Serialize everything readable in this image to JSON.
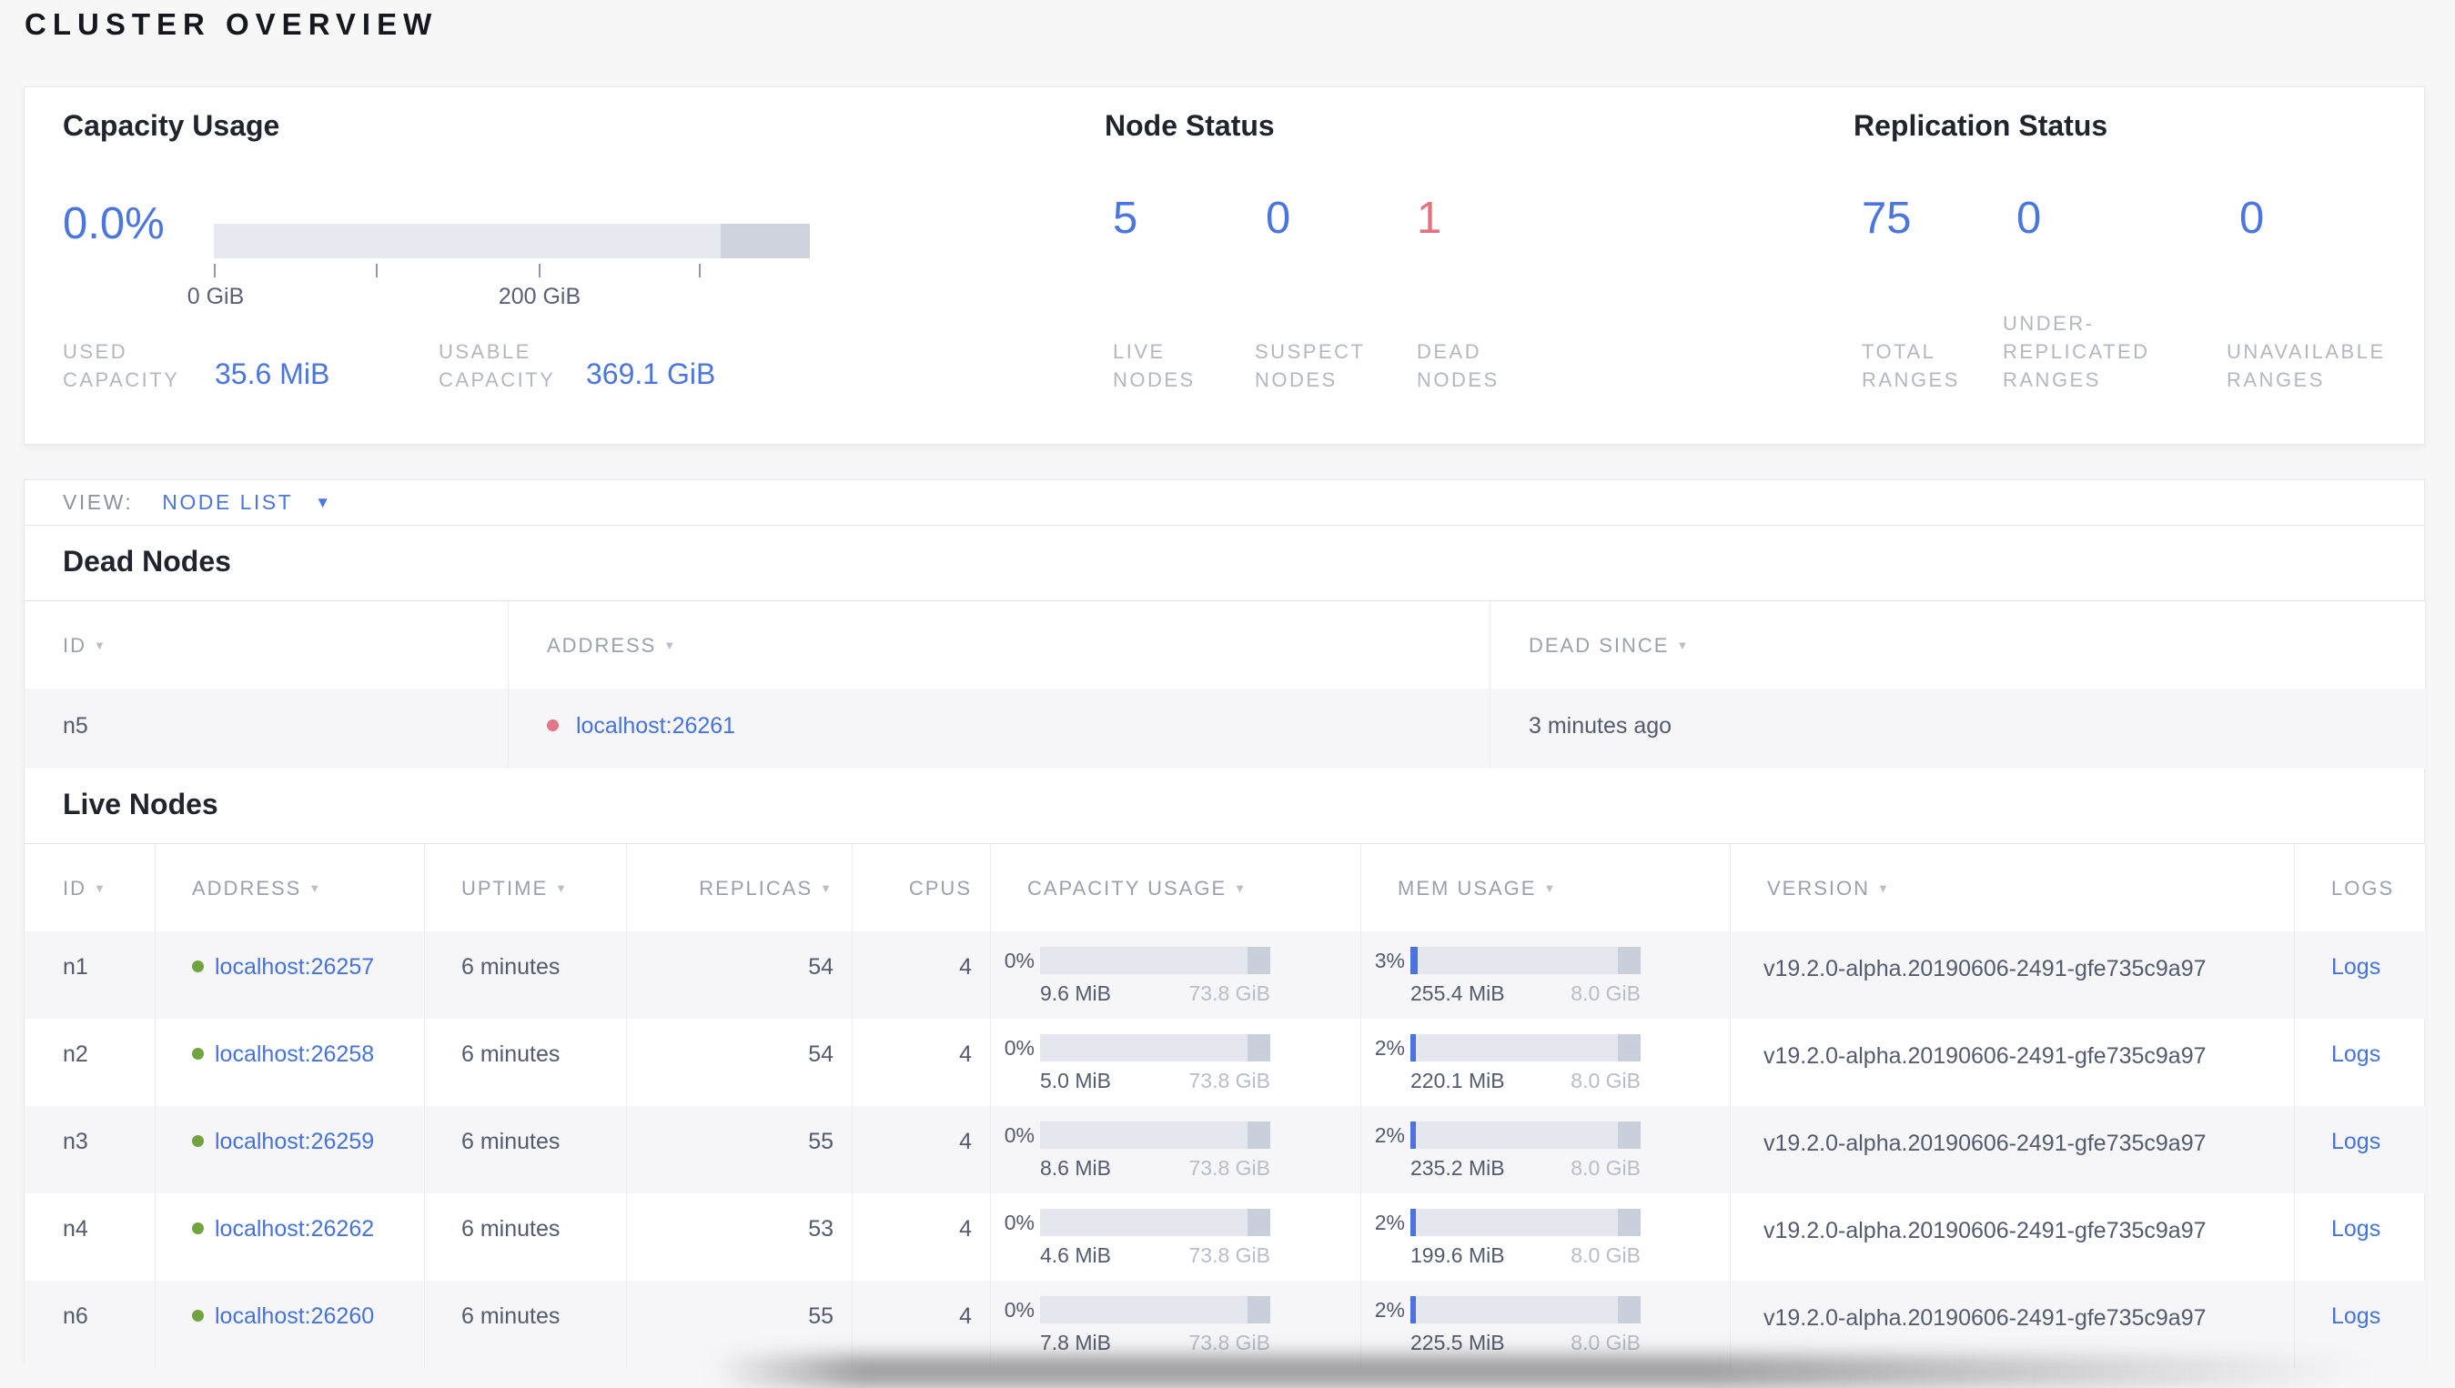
{
  "title": "CLUSTER OVERVIEW",
  "colors": {
    "accent_blue": "#4a76dd",
    "link_blue": "#4573da",
    "dead_red": "#e3717f",
    "live_dot_green": "#71a33e",
    "dead_dot_red": "#e0788a",
    "bar_track": "#e4e7ee",
    "bar_end_segment": "#c9cfdb",
    "bar_fill_blue": "#4a72e0"
  },
  "summary": {
    "capacity": {
      "title": "Capacity Usage",
      "percent": "0.0%",
      "tick_labels": [
        "0 GiB",
        "200 GiB"
      ],
      "used": {
        "label": "USED\nCAPACITY",
        "value": "35.6 MiB"
      },
      "usable": {
        "label": "USABLE\nCAPACITY",
        "value": "369.1 GiB"
      }
    },
    "node_status": {
      "title": "Node Status",
      "stats": [
        {
          "value": "5",
          "label": "LIVE\nNODES"
        },
        {
          "value": "0",
          "label": "SUSPECT\nNODES"
        },
        {
          "value": "1",
          "label": "DEAD\nNODES"
        }
      ]
    },
    "replication": {
      "title": "Replication Status",
      "stats": [
        {
          "value": "75",
          "label": "TOTAL\nRANGES"
        },
        {
          "value": "0",
          "label": "UNDER-\nREPLICATED\nRANGES"
        },
        {
          "value": "0",
          "label": "UNAVAILABLE\nRANGES"
        }
      ]
    }
  },
  "view_bar": {
    "label": "VIEW:",
    "selected": "NODE LIST"
  },
  "dead_nodes": {
    "title": "Dead Nodes",
    "columns": [
      {
        "label": "ID",
        "sortable": true
      },
      {
        "label": "ADDRESS",
        "sortable": true
      },
      {
        "label": "DEAD SINCE",
        "sortable": true
      }
    ],
    "rows": [
      {
        "id": "n5",
        "address": "localhost:26261",
        "dead_since": "3 minutes ago"
      }
    ]
  },
  "live_nodes": {
    "title": "Live Nodes",
    "columns": [
      {
        "label": "ID",
        "sortable": true
      },
      {
        "label": "ADDRESS",
        "sortable": true
      },
      {
        "label": "UPTIME",
        "sortable": true
      },
      {
        "label": "REPLICAS",
        "sortable": true
      },
      {
        "label": "CPUS",
        "sortable": false
      },
      {
        "label": "CAPACITY USAGE",
        "sortable": true
      },
      {
        "label": "MEM USAGE",
        "sortable": true
      },
      {
        "label": "VERSION",
        "sortable": true
      },
      {
        "label": "LOGS",
        "sortable": false
      }
    ],
    "rows": [
      {
        "id": "n1",
        "address": "localhost:26257",
        "uptime": "6 minutes",
        "replicas": "54",
        "cpus": "4",
        "capacity_percent": "0%",
        "capacity_fill": "0%",
        "capacity_used": "9.6 MiB",
        "capacity_total": "73.8 GiB",
        "mem_percent": "3%",
        "mem_fill": "3%",
        "mem_used": "255.4 MiB",
        "mem_total": "8.0 GiB",
        "version": "v19.2.0-alpha.20190606-2491-gfe735c9a97",
        "logs_label": "Logs"
      },
      {
        "id": "n2",
        "address": "localhost:26258",
        "uptime": "6 minutes",
        "replicas": "54",
        "cpus": "4",
        "capacity_percent": "0%",
        "capacity_fill": "0%",
        "capacity_used": "5.0 MiB",
        "capacity_total": "73.8 GiB",
        "mem_percent": "2%",
        "mem_fill": "2.5%",
        "mem_used": "220.1 MiB",
        "mem_total": "8.0 GiB",
        "version": "v19.2.0-alpha.20190606-2491-gfe735c9a97",
        "logs_label": "Logs"
      },
      {
        "id": "n3",
        "address": "localhost:26259",
        "uptime": "6 minutes",
        "replicas": "55",
        "cpus": "4",
        "capacity_percent": "0%",
        "capacity_fill": "0%",
        "capacity_used": "8.6 MiB",
        "capacity_total": "73.8 GiB",
        "mem_percent": "2%",
        "mem_fill": "2.5%",
        "mem_used": "235.2 MiB",
        "mem_total": "8.0 GiB",
        "version": "v19.2.0-alpha.20190606-2491-gfe735c9a97",
        "logs_label": "Logs"
      },
      {
        "id": "n4",
        "address": "localhost:26262",
        "uptime": "6 minutes",
        "replicas": "53",
        "cpus": "4",
        "capacity_percent": "0%",
        "capacity_fill": "0%",
        "capacity_used": "4.6 MiB",
        "capacity_total": "73.8 GiB",
        "mem_percent": "2%",
        "mem_fill": "2.5%",
        "mem_used": "199.6 MiB",
        "mem_total": "8.0 GiB",
        "version": "v19.2.0-alpha.20190606-2491-gfe735c9a97",
        "logs_label": "Logs"
      },
      {
        "id": "n6",
        "address": "localhost:26260",
        "uptime": "6 minutes",
        "replicas": "55",
        "cpus": "4",
        "capacity_percent": "0%",
        "capacity_fill": "0%",
        "capacity_used": "7.8 MiB",
        "capacity_total": "73.8 GiB",
        "mem_percent": "2%",
        "mem_fill": "2.5%",
        "mem_used": "225.5 MiB",
        "mem_total": "8.0 GiB",
        "version": "v19.2.0-alpha.20190606-2491-gfe735c9a97",
        "logs_label": "Logs"
      }
    ]
  }
}
